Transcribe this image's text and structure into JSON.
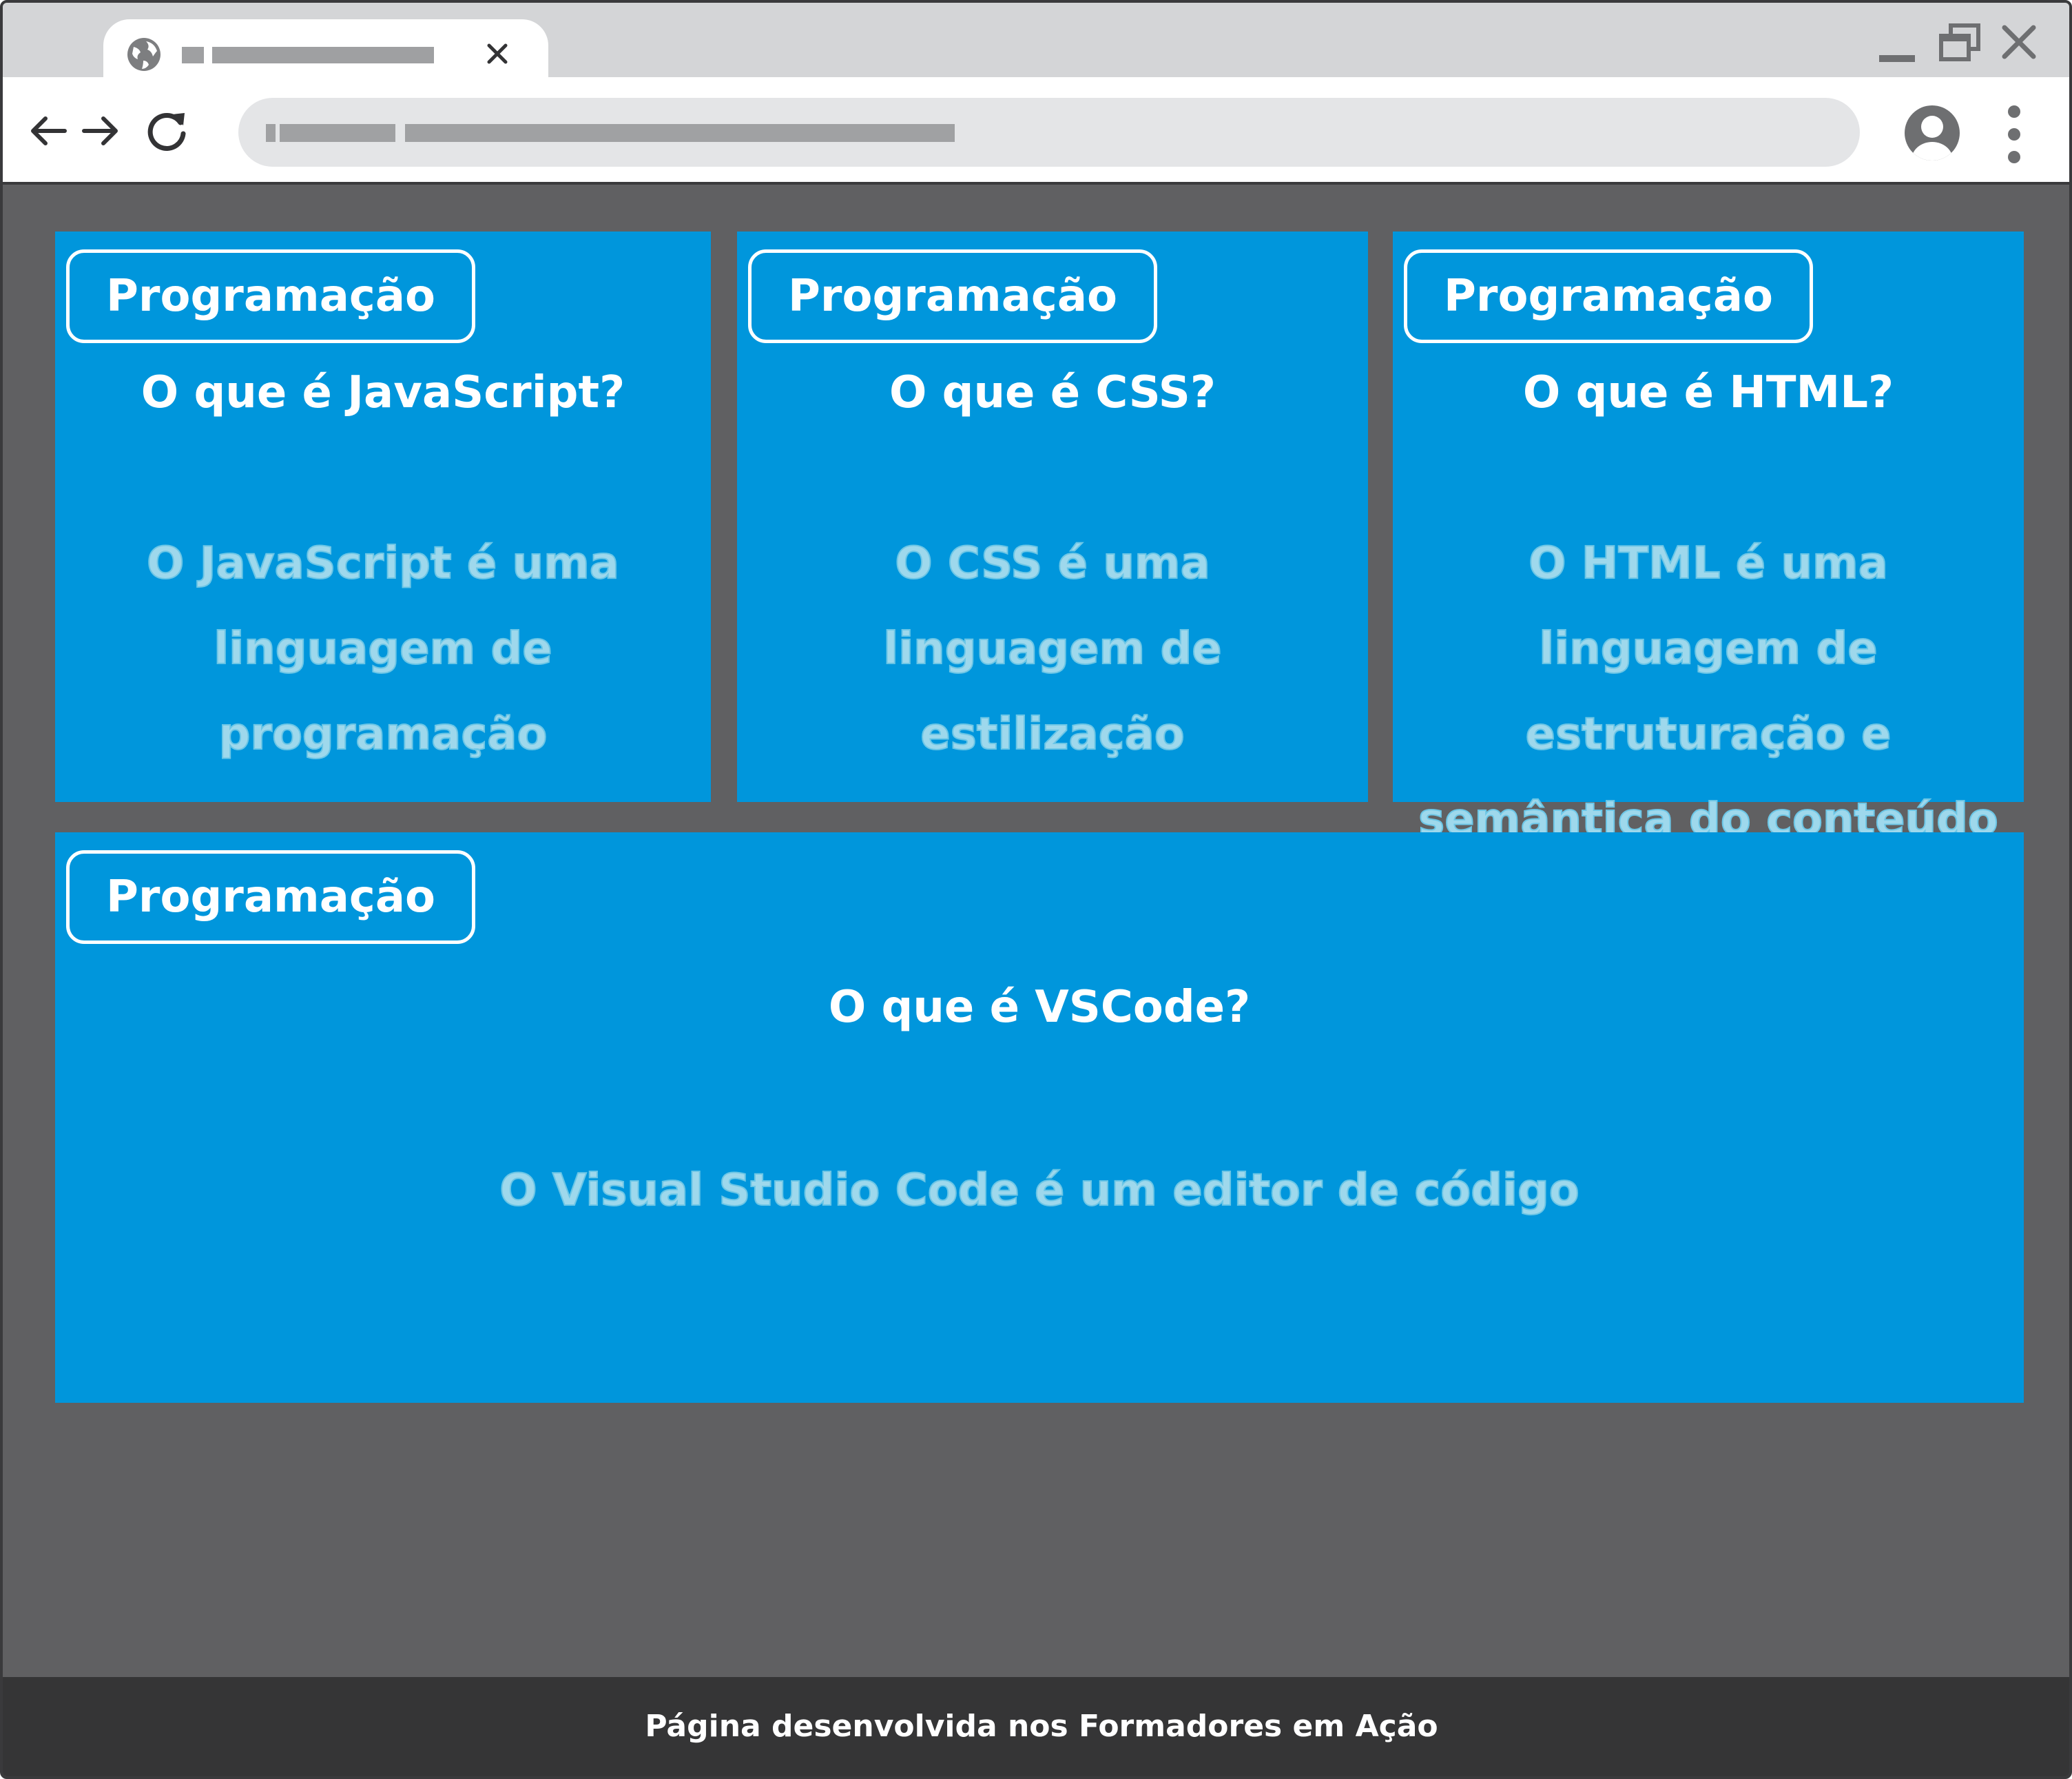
{
  "cards": [
    {
      "badge": "Programação",
      "question": "O que é JavaScript?",
      "answer": "O JavaScript é uma linguagem de programação"
    },
    {
      "badge": "Programação",
      "question": "O que é CSS?",
      "answer": "O CSS é uma linguagem de estilização"
    },
    {
      "badge": "Programação",
      "question": "O que é HTML?",
      "answer": "O HTML é uma linguagem de estruturação e semântica do conteúdo"
    },
    {
      "badge": "Programação",
      "question": "O que é VSCode?",
      "answer": "O Visual Studio Code é um editor de código"
    }
  ],
  "footer": {
    "text": "Página desenvolvida nos Formadores em Ação"
  },
  "colors": {
    "card_background": "#0096dc",
    "answer_text": "#9ed8ec",
    "page_background": "#606062",
    "footer_background": "#353536"
  },
  "icons": {
    "tab": "globe-icon",
    "tab_close": "close-icon",
    "back": "arrow-left-icon",
    "forward": "arrow-right-icon",
    "reload": "reload-icon",
    "profile": "user-icon",
    "menu": "kebab-menu-icon",
    "minimize": "minimize-icon",
    "maximize": "restore-icon",
    "close": "close-icon"
  }
}
